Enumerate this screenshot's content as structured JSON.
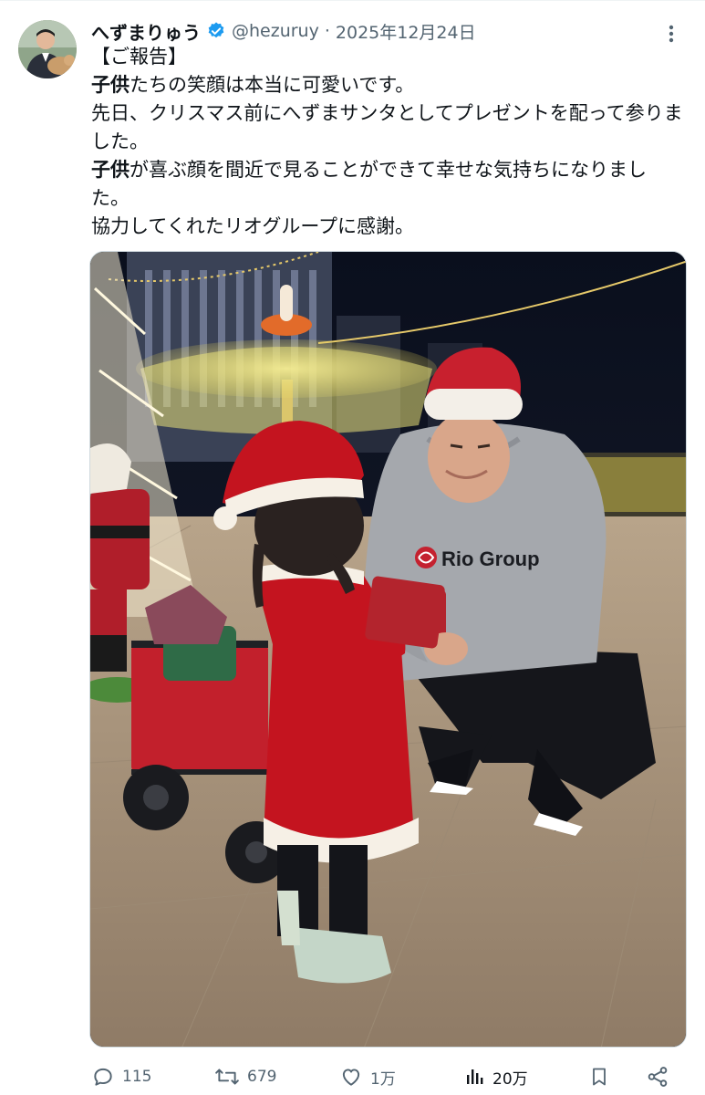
{
  "tweet": {
    "display_name": "へずまりゅう",
    "handle": "@hezuruy",
    "separator": "·",
    "date": "2025年12月24日",
    "verified_color": "#1d9bf0",
    "lines": [
      {
        "type": "plain",
        "text": "【ご報告】"
      },
      {
        "type": "rich",
        "bold": "子供",
        "rest": "たちの笑顔は本当に可愛いです。"
      },
      {
        "type": "plain",
        "text": "先日、クリスマス前にへずまサンタとしてプレゼントを配って参りました。"
      },
      {
        "type": "rich",
        "bold": "子供",
        "rest": "が喜ぶ顔を間近で見ることができて幸せな気持ちになりました。"
      },
      {
        "type": "plain",
        "text": "協力してくれたリオグループに感謝。"
      }
    ],
    "photo": {
      "hoodie_text": "Rio Group"
    },
    "metrics": {
      "replies": "115",
      "reposts": "679",
      "likes": "1万",
      "views": "20万"
    },
    "icons": [
      "more-icon",
      "reply-icon",
      "repost-icon",
      "like-icon",
      "views-icon",
      "bookmark-icon",
      "share-icon"
    ]
  }
}
